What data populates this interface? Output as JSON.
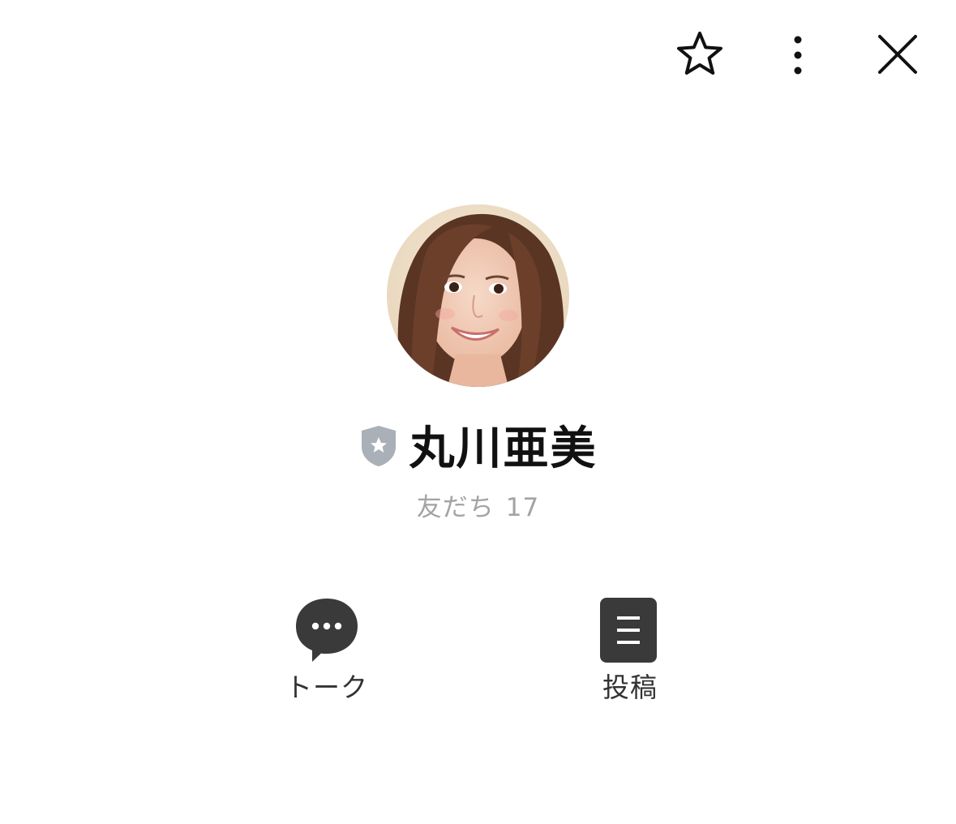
{
  "header": {
    "favorite_icon": "star-outline-icon",
    "more_icon": "vertical-ellipsis-icon",
    "close_icon": "close-x-icon"
  },
  "profile": {
    "name": "丸川亜美",
    "badge_icon": "shield-star-icon",
    "friends_label": "友だち",
    "friends_count": "17"
  },
  "actions": [
    {
      "label": "トーク",
      "icon": "chat-bubble-icon"
    },
    {
      "label": "投稿",
      "icon": "post-list-icon"
    }
  ],
  "colors": {
    "icon_dark": "#3a3a3a",
    "badge": "#aab0b8",
    "subtext": "#a3a3a3"
  }
}
